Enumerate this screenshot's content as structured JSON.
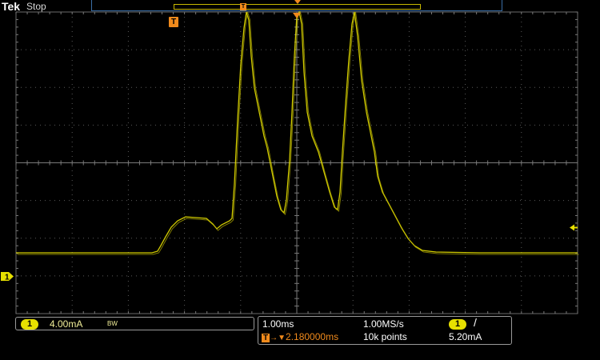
{
  "header": {
    "brand": "Tek",
    "status": "Stop"
  },
  "trigger_marker": {
    "label": "T"
  },
  "channel": {
    "number": "1",
    "scale": "4.00mA",
    "bandwidth_limit": "BW",
    "color": "#e7e000"
  },
  "timebase": {
    "horizontal_scale": "1.00ms",
    "sample_rate": "1.00MS/s",
    "trigger_delay_prefix": "T",
    "trigger_delay": "2.180000ms",
    "record_length": "10k points"
  },
  "trigger": {
    "source": "1",
    "slope": "/",
    "level": "5.20mA"
  },
  "colors": {
    "trace": "#e7e000",
    "trigger": "#f08a1c",
    "grid": "#5a5a5a",
    "graticule_box": "#3a6ea5"
  },
  "icons": {
    "trigger_position": "trigger-t-icon",
    "channel_ground": "channel-1-marker-icon",
    "trigger_level": "trigger-level-arrow-icon",
    "slope": "rising-edge-icon"
  }
}
